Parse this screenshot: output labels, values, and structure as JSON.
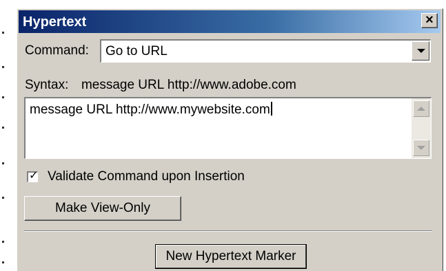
{
  "dialog": {
    "title": "Hypertext",
    "close_glyph": "×"
  },
  "command": {
    "label": "Command:",
    "value": "Go to URL"
  },
  "syntax": {
    "label": "Syntax:",
    "example": "message URL http://www.adobe.com"
  },
  "editor": {
    "value": "message URL http://www.mywebsite.com"
  },
  "validate": {
    "label": "Validate Command upon Insertion",
    "checked": true
  },
  "buttons": {
    "make_view_only": "Make View-Only",
    "new_marker": "New Hypertext Marker"
  },
  "colors": {
    "title_gradient_start": "#0a246a",
    "title_gradient_end": "#a6caf0",
    "dialog_face": "#d4d0c8"
  },
  "icons": {
    "close": "close-icon",
    "dropdown": "chevron-down-icon",
    "scroll_up": "scroll-up-arrow-icon",
    "scroll_down": "scroll-down-arrow-icon",
    "check": "checkmark-icon"
  }
}
